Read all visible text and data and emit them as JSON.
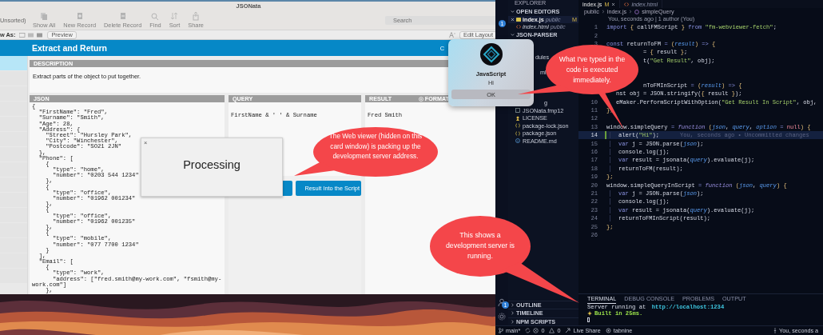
{
  "filemaker_window": {
    "title": "JSONata",
    "toolbar": {
      "sort_status": "Unsorted)",
      "tools": [
        {
          "kind": "records",
          "label": "Show All",
          "disabled": true
        },
        {
          "kind": "new",
          "label": "New Record",
          "disabled": true
        },
        {
          "kind": "delete",
          "label": "Delete Record",
          "disabled": true
        },
        {
          "kind": "find",
          "label": "Find",
          "disabled": true
        },
        {
          "kind": "sort",
          "label": "Sort",
          "disabled": true
        },
        {
          "kind": "share",
          "label": "Share",
          "disabled": true
        }
      ],
      "search": {
        "placeholder": "Search"
      }
    },
    "layout_bar": {
      "view_as": "w As:",
      "preview": "Preview",
      "edit_layout": "Edit Layout"
    },
    "header": {
      "title": "Extract and Return",
      "right_text": "C"
    },
    "description": {
      "label": "DESCRIPTION",
      "text": "Extract parts of the object to put together."
    },
    "json_panel": {
      "label": "JSON",
      "text": "{\n  \"FirstName\": \"Fred\",\n  \"Surname\": \"Smith\",\n  \"Age\": 28,\n  \"Address\": {\n    \"Street\": \"Hursley Park\",\n    \"City\": \"Winchester\",\n    \"Postcode\": \"SO21 2JN\"\n  },\n  \"Phone\": [\n    {\n      \"type\": \"home\",\n      \"number\": \"0203 544 1234\"\n    },\n    {\n      \"type\": \"office\",\n      \"number\": \"01962 001234\"\n    },\n    {\n      \"type\": \"office\",\n      \"number\": \"01962 001235\"\n    },\n    {\n      \"type\": \"mobile\",\n      \"number\": \"077 7700 1234\"\n    }\n  ],\n  \"Email\": [\n    {\n      \"type\": \"work\",\n      \"address\": [\"fred.smith@my-work.com\", \"fsmith@my-\nwork.com\"]\n    },"
    },
    "query_panel": {
      "label": "QUERY",
      "query": "FirstName & ' ' & Surname",
      "buttons": [
        "Result Into the Script"
      ]
    },
    "result_panel": {
      "label": "RESULT",
      "format": "FORMAT",
      "result": "Fred Smith"
    },
    "processing_dialog": {
      "message": "Processing",
      "close": "×"
    }
  },
  "javascript_alert": {
    "title": "JavaScript",
    "message": "Hi",
    "button": "OK"
  },
  "vscode": {
    "activity_bar": {
      "top_badge": "1",
      "bottom_badge": "1"
    },
    "sidebar": {
      "title": "EXPLORER",
      "open_editors": {
        "title": "OPEN EDITORS",
        "items": [
          {
            "name": "index.js",
            "path": "public",
            "badge": "M",
            "selected": true
          },
          {
            "name": "index.html",
            "path": "public",
            "selected": false
          }
        ]
      },
      "project": {
        "title": "JSON-PARSER",
        "items": [
          {
            "kind": "fragment",
            "name": "dules"
          },
          {
            "kind": "fragment",
            "name": "ml"
          },
          {
            "kind": "fragment",
            "name": "g"
          },
          {
            "kind": "fmp",
            "name": "JSONata.fmp12"
          },
          {
            "kind": "license",
            "name": "LICENSE"
          },
          {
            "kind": "json",
            "name": "package-lock.json"
          },
          {
            "kind": "json",
            "name": "package.json"
          },
          {
            "kind": "info",
            "name": "README.md"
          }
        ]
      },
      "bottom_sections": [
        "OUTLINE",
        "TIMELINE",
        "NPM SCRIPTS"
      ]
    },
    "tabs": [
      {
        "label": "index.js",
        "badge": "M",
        "selected": true
      },
      {
        "label": "index.html",
        "selected": false
      }
    ],
    "breadcrumb": [
      "public",
      "index.js",
      "simpleQuery"
    ],
    "codelens": "You, seconds ago | 1 author (You)",
    "lines": [
      {
        "kind": "code",
        "number": "1",
        "tokens": [
          {
            "kind": "kw",
            "t": "import "
          },
          {
            "kind": "br",
            "t": "{ "
          },
          {
            "kind": "id",
            "t": "callFMScript "
          },
          {
            "kind": "br",
            "t": "} "
          },
          {
            "kind": "kw",
            "t": "from "
          },
          {
            "kind": "str",
            "t": "\"fm-webviewer-fetch\""
          },
          {
            "kind": "id",
            "t": ";"
          }
        ]
      },
      {
        "kind": "code",
        "number": "2"
      },
      {
        "kind": "code",
        "number": "3",
        "tokens": [
          {
            "kind": "kw",
            "t": "const "
          },
          {
            "kind": "id",
            "t": "returnToFM "
          },
          {
            "kind": "kw",
            "t": "= "
          },
          {
            "kind": "br",
            "t": "("
          },
          {
            "kind": "par",
            "t": "result"
          },
          {
            "kind": "br",
            "t": ")"
          },
          {
            "kind": "kw",
            "t": " => "
          },
          {
            "kind": "br",
            "t": "{"
          }
        ]
      },
      {
        "kind": "fragment",
        "tokens": [
          {
            "kind": "id",
            "t": "= "
          },
          {
            "kind": "br",
            "t": "{ "
          },
          {
            "kind": "id",
            "t": "result "
          },
          {
            "kind": "br",
            "t": "}"
          },
          {
            "kind": "id",
            "t": ";"
          }
        ]
      },
      {
        "kind": "fragment",
        "tokens": [
          {
            "kind": "id",
            "t": "t("
          },
          {
            "kind": "str",
            "t": "\"Get Result\""
          },
          {
            "kind": "id",
            "t": ", obj);"
          }
        ]
      },
      {
        "kind": "covered"
      },
      {
        "kind": "covered"
      },
      {
        "kind": "fragment",
        "tokens": [
          {
            "kind": "id",
            "t": "nToFMInScript "
          },
          {
            "kind": "kw",
            "t": "= "
          },
          {
            "kind": "br",
            "t": "("
          },
          {
            "kind": "par",
            "t": "result"
          },
          {
            "kind": "br",
            "t": ")"
          },
          {
            "kind": "kw",
            "t": " => "
          },
          {
            "kind": "br",
            "t": "{"
          }
        ]
      },
      {
        "kind": "fragment",
        "tokens": [
          {
            "kind": "id",
            "t": "nst obj = JSON.stringify("
          },
          {
            "kind": "br",
            "t": "{ "
          },
          {
            "kind": "id",
            "t": "result "
          },
          {
            "kind": "br",
            "t": "}"
          },
          {
            "kind": "id",
            "t": ");"
          }
        ]
      },
      {
        "kind": "fragment",
        "number": "10",
        "tokens": [
          {
            "kind": "id",
            "t": "eMaker.PerformScriptWithOption("
          },
          {
            "kind": "str",
            "t": "\"Get Result In Script\""
          },
          {
            "kind": "id",
            "t": ", obj,"
          }
        ]
      },
      {
        "kind": "code",
        "number": "11",
        "tokens": [
          {
            "kind": "br",
            "t": "};"
          }
        ]
      },
      {
        "kind": "code",
        "number": "12"
      },
      {
        "kind": "code",
        "number": "13",
        "tokens": [
          {
            "kind": "id",
            "t": "window.simpleQuery "
          },
          {
            "kind": "kw",
            "t": "= "
          },
          {
            "kind": "kwi",
            "t": "function "
          },
          {
            "kind": "br",
            "t": "("
          },
          {
            "kind": "par",
            "t": "json"
          },
          {
            "kind": "id",
            "t": ", "
          },
          {
            "kind": "par",
            "t": "query"
          },
          {
            "kind": "id",
            "t": ", "
          },
          {
            "kind": "par",
            "t": "option "
          },
          {
            "kind": "kw",
            "t": "= "
          },
          {
            "kind": "con",
            "t": "null"
          },
          {
            "kind": "br",
            "t": ") {"
          }
        ]
      },
      {
        "kind": "code",
        "number": "14",
        "current": true,
        "indented": true,
        "annotation": "You, seconds ago • Uncommitted changes",
        "tokens": [
          {
            "kind": "id",
            "t": "alert("
          },
          {
            "kind": "str",
            "t": "\"Hi\""
          },
          {
            "kind": "id",
            "t": ");"
          }
        ]
      },
      {
        "kind": "code",
        "number": "15",
        "indented": true,
        "tokens": [
          {
            "kind": "kw",
            "t": "var "
          },
          {
            "kind": "id",
            "t": "j = JSON.parse("
          },
          {
            "kind": "par",
            "t": "json"
          },
          {
            "kind": "id",
            "t": ");"
          }
        ]
      },
      {
        "kind": "code",
        "number": "16",
        "indented": true,
        "tokens": [
          {
            "kind": "id",
            "t": "console.log(j);"
          }
        ]
      },
      {
        "kind": "code",
        "number": "17",
        "indented": true,
        "tokens": [
          {
            "kind": "kw",
            "t": "var "
          },
          {
            "kind": "id",
            "t": "result = jsonata("
          },
          {
            "kind": "par",
            "t": "query"
          },
          {
            "kind": "id",
            "t": ").evaluate(j);"
          }
        ]
      },
      {
        "kind": "code",
        "number": "18",
        "indented": true,
        "tokens": [
          {
            "kind": "id",
            "t": "returnToFM(result);"
          }
        ]
      },
      {
        "kind": "code",
        "number": "19",
        "tokens": [
          {
            "kind": "br",
            "t": "};"
          }
        ]
      },
      {
        "kind": "code",
        "number": "20",
        "tokens": [
          {
            "kind": "id",
            "t": "window.simpleQueryInScript "
          },
          {
            "kind": "kw",
            "t": "= "
          },
          {
            "kind": "kwi",
            "t": "function "
          },
          {
            "kind": "br",
            "t": "("
          },
          {
            "kind": "par",
            "t": "json"
          },
          {
            "kind": "id",
            "t": ", "
          },
          {
            "kind": "par",
            "t": "query"
          },
          {
            "kind": "br",
            "t": ") {"
          }
        ]
      },
      {
        "kind": "code",
        "number": "21",
        "indented": true,
        "tokens": [
          {
            "kind": "kw",
            "t": "var "
          },
          {
            "kind": "id",
            "t": "j = JSON.parse("
          },
          {
            "kind": "par",
            "t": "json"
          },
          {
            "kind": "id",
            "t": ");"
          }
        ]
      },
      {
        "kind": "code",
        "number": "22",
        "indented": true,
        "tokens": [
          {
            "kind": "id",
            "t": "console.log(j);"
          }
        ]
      },
      {
        "kind": "code",
        "number": "23",
        "indented": true,
        "tokens": [
          {
            "kind": "kw",
            "t": "var "
          },
          {
            "kind": "id",
            "t": "result = jsonata("
          },
          {
            "kind": "par",
            "t": "query"
          },
          {
            "kind": "id",
            "t": ").evaluate(j);"
          }
        ]
      },
      {
        "kind": "code",
        "number": "24",
        "indented": true,
        "tokens": [
          {
            "kind": "id",
            "t": "returnToFMInScript(result);"
          }
        ]
      },
      {
        "kind": "code",
        "number": "25",
        "tokens": [
          {
            "kind": "br",
            "t": "};"
          }
        ]
      },
      {
        "kind": "code",
        "number": "26"
      }
    ],
    "terminal": {
      "tabs": [
        {
          "label": "TERMINAL",
          "selected": true
        },
        {
          "label": "DEBUG CONSOLE",
          "selected": false
        },
        {
          "label": "PROBLEMS",
          "selected": false
        },
        {
          "label": "OUTPUT",
          "selected": false
        }
      ],
      "server_text": "Server running at ",
      "server_url": "http://localhost:1234",
      "built": "Built in 25ms."
    },
    "status_bar": {
      "branch": "main*",
      "errors": "0",
      "warnings": "0",
      "live_share": "Live Share",
      "tabnine": "tabnine",
      "blame": "You, seconds a"
    }
  },
  "callouts": [
    {
      "text": "What I've typed in the code is executed immediately."
    },
    {
      "text": "The Web viewer (hidden on this card window) is packing up the development server address."
    },
    {
      "text": "This shows a development server is running."
    }
  ]
}
